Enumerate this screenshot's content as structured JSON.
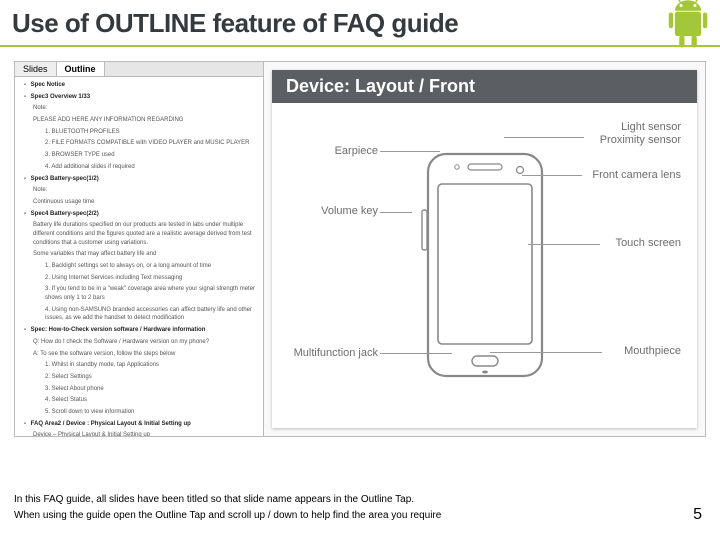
{
  "title": "Use of OUTLINE feature of FAQ guide",
  "tabs": {
    "slides": "Slides",
    "outline": "Outline"
  },
  "outline": [
    {
      "l": "h1",
      "t": "Spec Notice",
      "c": "-"
    },
    {
      "l": "h1",
      "t": "Spec3 Overview 1/33",
      "c": "-"
    },
    {
      "l": "sub",
      "t": "Note:"
    },
    {
      "l": "sub",
      "t": "PLEASE ADD HERE ANY INFORMATION REGARDING"
    },
    {
      "l": "subsub",
      "t": "1. BLUETOOTH PROFILES"
    },
    {
      "l": "subsub",
      "t": "2. FILE FORMATS COMPATIBLE with VIDEO PLAYER and MUSIC PLAYER"
    },
    {
      "l": "subsub",
      "t": "3. BROWSER TYPE used"
    },
    {
      "l": "subsub",
      "t": "4. Add additional slides if required"
    },
    {
      "l": "h1",
      "t": "Spec3 Battery-spec(1/2)",
      "c": "-"
    },
    {
      "l": "sub",
      "t": "Note:"
    },
    {
      "l": "sub",
      "t": "Continuous usage time"
    },
    {
      "l": "h1",
      "t": "Spec4 Battery-spec(2/2)",
      "c": "-"
    },
    {
      "l": "sub",
      "t": "Battery life durations specified on our products are tested in labs under multiple different conditions and the figures quoted are a realistic average derived from test conditions that a customer using variations."
    },
    {
      "l": "sub",
      "t": "Some variables that may affect battery life and"
    },
    {
      "l": "subsub",
      "t": "1. Backlight settings set to always on, or a long amount of time"
    },
    {
      "l": "subsub",
      "t": "2. Using Internet Services including Text messaging"
    },
    {
      "l": "subsub",
      "t": "3. If you tend to be in a \"weak\" coverage area where your signal strength meter shows only 1 to 2 bars"
    },
    {
      "l": "subsub",
      "t": "4. Using non-SAMSUNG branded accessories can affect battery life and other issues, as we add the handset to detect modification"
    },
    {
      "l": "h1",
      "t": "Spec: How-to-Check version software / Hardware information",
      "c": "-"
    },
    {
      "l": "sub",
      "t": "Q: How do I check the Software / Hardware version on my phone?"
    },
    {
      "l": "sub",
      "t": "A: To see the software version, follow the steps below"
    },
    {
      "l": "subsub",
      "t": "1. Whilst in standby mode, tap Applications"
    },
    {
      "l": "subsub",
      "t": "2. Select Settings"
    },
    {
      "l": "subsub",
      "t": "3. Select About phone"
    },
    {
      "l": "subsub",
      "t": "4. Select Status"
    },
    {
      "l": "subsub",
      "t": "5. Scroll down to view information"
    },
    {
      "l": "h1",
      "t": "FAQ Area2 / Device : Physical Layout & Initial Setting up",
      "c": "-"
    },
    {
      "l": "sub",
      "t": "Device – Physical Layout & Initial Setting up"
    }
  ],
  "slide": {
    "title": "Device: Layout / Front",
    "labels": {
      "earpiece": "Earpiece",
      "volume": "Volume key",
      "multijack": "Multifunction jack",
      "light": "Light sensor",
      "proximity": "Proximity sensor",
      "camera": "Front camera lens",
      "touch": "Touch screen",
      "mouth": "Mouthpiece"
    }
  },
  "footer": {
    "line1": "In this FAQ guide, all slides have been titled so that slide name appears in the Outline Tap.",
    "line2": "When using the guide open the Outline Tap and scroll up / down to help find the area you require",
    "page": "5"
  }
}
